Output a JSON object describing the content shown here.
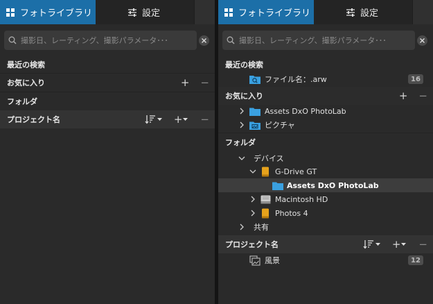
{
  "tabs": {
    "library_label": "フォトライブラリ",
    "settings_label": "設定"
  },
  "search": {
    "placeholder": "撮影日、レーティング、撮影パラメータ･･･"
  },
  "sections": {
    "recent_searches": "最近の検索",
    "favorites": "お気に入り",
    "folders": "フォルダ",
    "projects": "プロジェクト名"
  },
  "recent_search_items": [
    {
      "label": "ファイル名：.arw",
      "count": "16"
    }
  ],
  "favorite_items": [
    {
      "label": "Assets DxO PhotoLab"
    },
    {
      "label": "ピクチャ"
    }
  ],
  "folder_tree": {
    "devices": "デバイス",
    "gdrive": "G-Drive GT",
    "assets": "Assets DxO PhotoLab",
    "macintosh": "Macintosh HD",
    "photos": "Photos 4",
    "shared": "共有"
  },
  "project_items": [
    {
      "label": "風景",
      "count": "12"
    }
  ],
  "actions": {
    "add": "+",
    "remove": "−"
  },
  "colors": {
    "accent": "#1c6fa8",
    "panel": "#2a2a2a",
    "folder_blue": "#3aa0e0",
    "drive_orange": "#e6a21c"
  }
}
